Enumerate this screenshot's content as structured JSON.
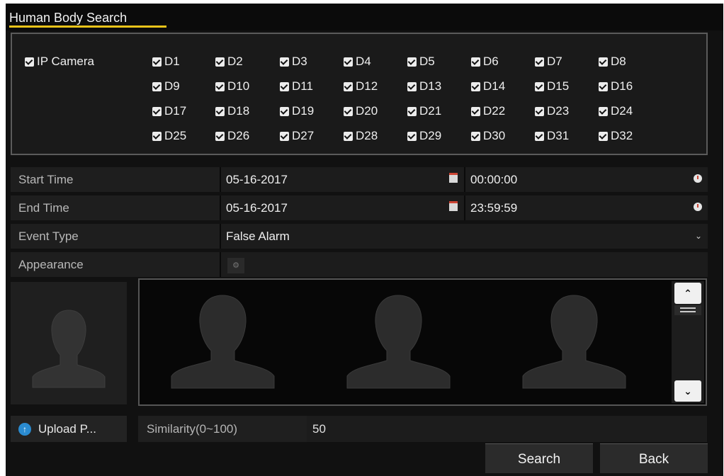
{
  "title": "Human Body Search",
  "camera": {
    "group_label": "IP Camera",
    "channels": [
      "D1",
      "D2",
      "D3",
      "D4",
      "D5",
      "D6",
      "D7",
      "D8",
      "D9",
      "D10",
      "D11",
      "D12",
      "D13",
      "D14",
      "D15",
      "D16",
      "D17",
      "D18",
      "D19",
      "D20",
      "D21",
      "D22",
      "D23",
      "D24",
      "D25",
      "D26",
      "D27",
      "D28",
      "D29",
      "D30",
      "D31",
      "D32"
    ]
  },
  "fields": {
    "start_time": {
      "label": "Start Time",
      "date": "05-16-2017",
      "time": "00:00:00"
    },
    "end_time": {
      "label": "End Time",
      "date": "05-16-2017",
      "time": "23:59:59"
    },
    "event_type": {
      "label": "Event Type",
      "value": "False Alarm"
    },
    "appearance": {
      "label": "Appearance"
    }
  },
  "upload_label": "Upload P...",
  "similarity": {
    "label": "Similarity(0~100)",
    "value": "50"
  },
  "buttons": {
    "search": "Search",
    "back": "Back"
  },
  "colors": {
    "accent_underline": "#e8c31a",
    "upload_icon": "#2a8bd0"
  }
}
